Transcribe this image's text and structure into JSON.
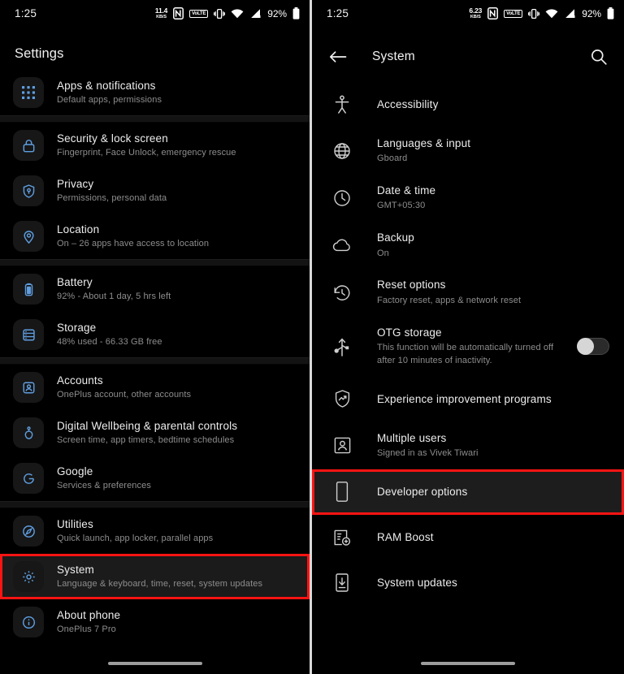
{
  "left": {
    "status_bar": {
      "clock": "1:25",
      "net_speed_value": "11.4",
      "net_speed_unit": "KB/S",
      "nfc": "nfc-icon",
      "volte": "VoLTE",
      "vibrate": "vibrate-icon",
      "wifi": "wifi-icon",
      "signal": "cellular-signal-icon",
      "battery_percent": "92%",
      "battery": "battery-icon"
    },
    "title": "Settings",
    "groups": [
      {
        "items": [
          {
            "icon": "apps-grid-icon",
            "title": "Apps & notifications",
            "subtitle": "Default apps, permissions"
          }
        ]
      },
      {
        "items": [
          {
            "icon": "lock-icon",
            "title": "Security & lock screen",
            "subtitle": "Fingerprint, Face Unlock, emergency rescue"
          },
          {
            "icon": "shield-key-icon",
            "title": "Privacy",
            "subtitle": "Permissions, personal data"
          },
          {
            "icon": "location-pin-icon",
            "title": "Location",
            "subtitle": "On – 26 apps have access to location"
          }
        ]
      },
      {
        "items": [
          {
            "icon": "battery-icon",
            "title": "Battery",
            "subtitle": "92% - About 1 day, 5 hrs left"
          },
          {
            "icon": "storage-icon",
            "title": "Storage",
            "subtitle": "48% used - 66.33 GB free"
          }
        ]
      },
      {
        "items": [
          {
            "icon": "account-icon",
            "title": "Accounts",
            "subtitle": "OnePlus account, other accounts"
          },
          {
            "icon": "wellbeing-icon",
            "title": "Digital Wellbeing & parental controls",
            "subtitle": "Screen time, app timers, bedtime schedules"
          },
          {
            "icon": "google-g-icon",
            "title": "Google",
            "subtitle": "Services & preferences"
          }
        ]
      },
      {
        "items": [
          {
            "icon": "utilities-icon",
            "title": "Utilities",
            "subtitle": "Quick launch, app locker, parallel apps"
          },
          {
            "icon": "gear-icon",
            "title": "System",
            "subtitle": "Language & keyboard, time, reset, system updates",
            "highlighted": true
          },
          {
            "icon": "info-icon",
            "title": "About phone",
            "subtitle": "OnePlus 7 Pro"
          }
        ]
      }
    ]
  },
  "right": {
    "status_bar": {
      "clock": "1:25",
      "net_speed_value": "6.23",
      "net_speed_unit": "KB/S",
      "nfc": "nfc-icon",
      "volte": "VoLTE",
      "vibrate": "vibrate-icon",
      "wifi": "wifi-icon",
      "signal": "cellular-signal-icon",
      "battery_percent": "92%",
      "battery": "battery-icon"
    },
    "appbar": {
      "back": "back-arrow-icon",
      "title": "System",
      "search": "search-icon"
    },
    "items": [
      {
        "icon": "accessibility-icon",
        "title": "Accessibility",
        "subtitle": ""
      },
      {
        "icon": "globe-icon",
        "title": "Languages & input",
        "subtitle": "Gboard"
      },
      {
        "icon": "clock-icon",
        "title": "Date & time",
        "subtitle": "GMT+05:30"
      },
      {
        "icon": "cloud-icon",
        "title": "Backup",
        "subtitle": "On"
      },
      {
        "icon": "history-reset-icon",
        "title": "Reset options",
        "subtitle": "Factory reset, apps & network reset"
      },
      {
        "icon": "usb-otg-icon",
        "title": "OTG storage",
        "subtitle": "This function will be automatically turned off after 10 minutes of inactivity.",
        "toggle": "off"
      },
      {
        "icon": "shield-trend-icon",
        "title": "Experience improvement programs",
        "subtitle": ""
      },
      {
        "icon": "multi-user-icon",
        "title": "Multiple users",
        "subtitle": "Signed in as Vivek Tiwari"
      },
      {
        "icon": "phone-outline-icon",
        "title": "Developer options",
        "subtitle": "",
        "highlighted": true
      },
      {
        "icon": "ram-boost-icon",
        "title": "RAM Boost",
        "subtitle": ""
      },
      {
        "icon": "system-update-icon",
        "title": "System updates",
        "subtitle": ""
      }
    ]
  },
  "colors": {
    "background": "#000000",
    "highlight_border": "#fc1413",
    "icon_accent": "#5f9ee0",
    "primary_text": "#ededed",
    "secondary_text": "#8d8d8d"
  }
}
